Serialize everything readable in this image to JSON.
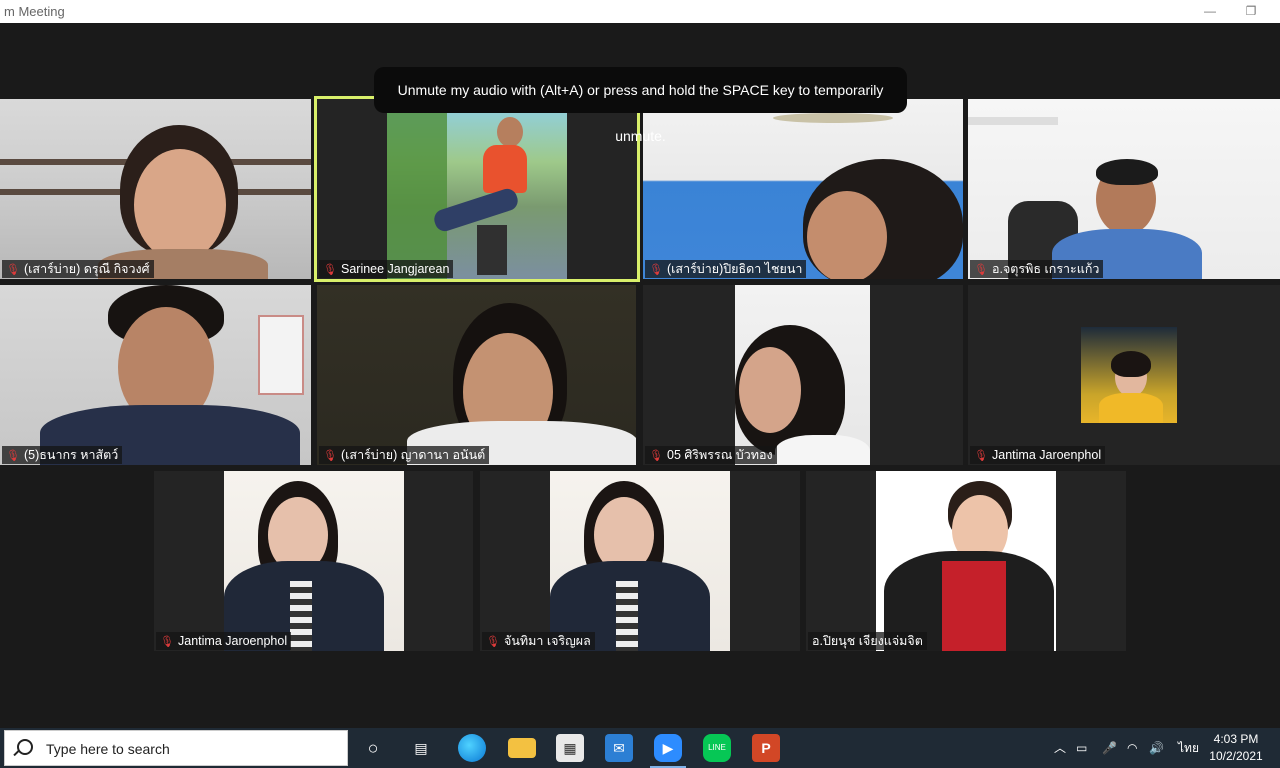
{
  "window": {
    "title": "m Meeting",
    "minimize_icon": "minimize-icon",
    "restore_icon": "restore-icon"
  },
  "notification": {
    "text": "Unmute my audio with (Alt+A) or press and hold the SPACE key to temporarily unmute."
  },
  "participants": [
    {
      "name": "(เสาร์บ่าย) ดรุณี กิจวงศ์",
      "muted": true,
      "active": false
    },
    {
      "name": "Sarinee Jangjarean",
      "muted": true,
      "active": true
    },
    {
      "name": "(เสาร์บ่าย)ปิยธิดา ไชยนา",
      "muted": true,
      "active": false
    },
    {
      "name": "อ.จตุรพิธ เกราะแก้ว",
      "muted": true,
      "active": false
    },
    {
      "name": "(5)ธนากร หาสัตว์",
      "muted": true,
      "active": false
    },
    {
      "name": "(เสาร์บ่าย) ญาดานา อนันต์",
      "muted": true,
      "active": false
    },
    {
      "name": "05 ศิริพรรณ บัวทอง",
      "muted": true,
      "active": false
    },
    {
      "name": "Jantima Jaroenphol",
      "muted": true,
      "active": false
    },
    {
      "name": "Jantima Jaroenphol",
      "muted": true,
      "active": false
    },
    {
      "name": "จันทิมา เจริญผล",
      "muted": true,
      "active": false
    },
    {
      "name": "อ.ปิยนุช เจียงแจ่มจิต",
      "muted": false,
      "active": false
    }
  ],
  "taskbar": {
    "search_placeholder": "Type here to search",
    "apps": [
      "cortana-icon",
      "task-view-icon",
      "edge-icon",
      "file-explorer-icon",
      "store-icon",
      "mail-icon",
      "zoom-icon",
      "line-icon",
      "powerpoint-icon"
    ],
    "language": "ไทย",
    "time": "4:03 PM",
    "date": "10/2/2021"
  },
  "colors": {
    "active_border": "#d9f06b",
    "muted_icon": "#e03b3b",
    "taskbar": "#1f2a35",
    "zoom_blue": "#2d8cff",
    "line_green": "#06c755",
    "ppt_orange": "#d24726"
  }
}
